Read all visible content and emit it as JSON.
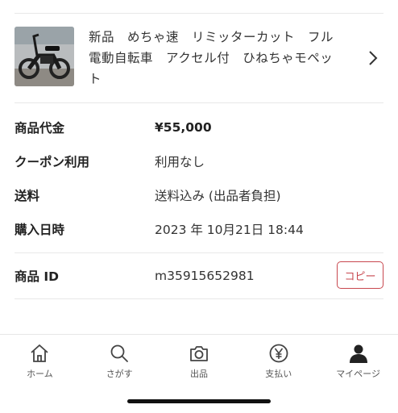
{
  "product": {
    "title": "新品　めちゃ速　リミッターカット　フル電動自転車　アクセル付　ひねちゃモペット"
  },
  "details": [
    {
      "label": "商品代金",
      "value": "¥55,000"
    },
    {
      "label": "クーポン利用",
      "value": "利用なし"
    },
    {
      "label": "送料",
      "value": "送料込み (出品者負担)"
    },
    {
      "label": "購入日時",
      "value": "2023 年 10月21日 18:44"
    }
  ],
  "item_id": {
    "label": "商品 ID",
    "value": "m35915652981",
    "copy_label": "コピー"
  },
  "tabbar": [
    {
      "label": "ホーム",
      "icon": "home-icon"
    },
    {
      "label": "さがす",
      "icon": "search-icon"
    },
    {
      "label": "出品",
      "icon": "camera-icon"
    },
    {
      "label": "支払い",
      "icon": "yen-icon"
    },
    {
      "label": "マイページ",
      "icon": "person-icon"
    }
  ],
  "colors": {
    "accent": "#c8484f",
    "divider": "#e8e8e8",
    "text": "#333333"
  }
}
